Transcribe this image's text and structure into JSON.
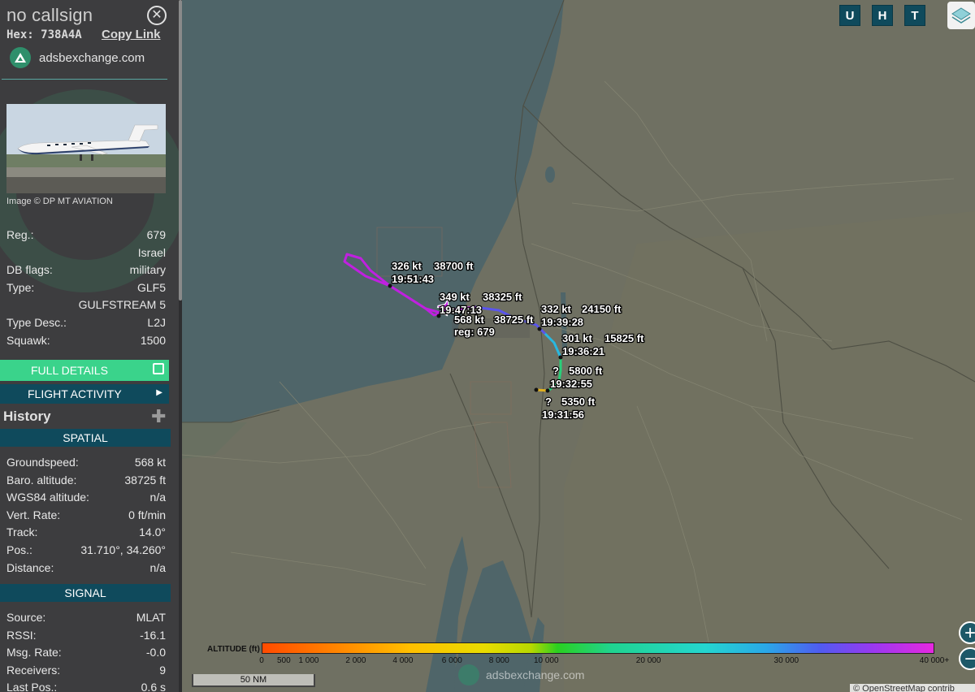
{
  "sidebar": {
    "callsign": "no callsign",
    "hex_label": "Hex:",
    "hex_value": "738A4A",
    "copy_link": "Copy Link",
    "brand": "adsbexchange.com",
    "image_credit": "Image © DP MT AVIATION",
    "details": [
      {
        "key": "Reg.:",
        "value": "679"
      },
      {
        "key": "",
        "value": "Israel"
      },
      {
        "key": "DB flags:",
        "value": "military"
      },
      {
        "key": "Type:",
        "value": "GLF5"
      },
      {
        "key": "",
        "value": "GULFSTREAM 5"
      },
      {
        "key": "Type Desc.:",
        "value": "L2J"
      },
      {
        "key": "Squawk:",
        "value": "1500"
      }
    ],
    "full_details": "FULL DETAILS",
    "flight_activity": "FLIGHT ACTIVITY",
    "history": "History",
    "spatial_header": "SPATIAL",
    "spatial": [
      {
        "key": "Groundspeed:",
        "value": "568 kt"
      },
      {
        "key": "Baro. altitude:",
        "value": "38725 ft"
      },
      {
        "key": "WGS84 altitude:",
        "value": "n/a"
      },
      {
        "key": "Vert. Rate:",
        "value": "0 ft/min"
      },
      {
        "key": "Track:",
        "value": "14.0°"
      },
      {
        "key": "Pos.:",
        "value": "31.710°, 34.260°"
      },
      {
        "key": "Distance:",
        "value": "n/a"
      }
    ],
    "signal_header": "SIGNAL",
    "signal": [
      {
        "key": "Source:",
        "value": "MLAT"
      },
      {
        "key": "RSSI:",
        "value": "-16.1"
      },
      {
        "key": "Msg. Rate:",
        "value": "-0.0"
      },
      {
        "key": "Receivers:",
        "value": "9"
      },
      {
        "key": "Last Pos.:",
        "value": "0.6 s"
      }
    ]
  },
  "toolbar": {
    "u": "U",
    "h": "H",
    "t": "T"
  },
  "map_labels": {
    "l1_speed": "326 kt",
    "l1_alt": "38700 ft",
    "l1_time": "19:51:43",
    "l2_speed": "349 kt",
    "l2_alt": "38325 ft",
    "l2_time": "19:47:13",
    "l3_speed": "568 kt",
    "l3_alt": "38725 ft",
    "l3_reg": "reg: 679",
    "l4_speed": "332 kt",
    "l4_alt": "24150 ft",
    "l4_time": "19:39:28",
    "l5_speed": "301 kt",
    "l5_alt": "15825 ft",
    "l5_time": "19:36:21",
    "l6_speed": "?",
    "l6_alt": "5800 ft",
    "l6_time": "19:32:55",
    "l7_speed": "?",
    "l7_alt": "5350 ft",
    "l7_time": "19:31:56"
  },
  "altitude_legend": {
    "title": "ALTITUDE (ft)",
    "ticks": [
      "0",
      "500",
      "1 000",
      "2 000",
      "4 000",
      "6 000",
      "8 000",
      "10 000",
      "20 000",
      "30 000",
      "40 000+"
    ]
  },
  "scale_label": "50 NM",
  "watermark": "adsbexchange.com",
  "attribution": "© OpenStreetMap contrib",
  "colors": {
    "accent_teal": "#0f4a5c",
    "full_details_green": "#3ad38b",
    "track_purple": "#c020e0"
  }
}
